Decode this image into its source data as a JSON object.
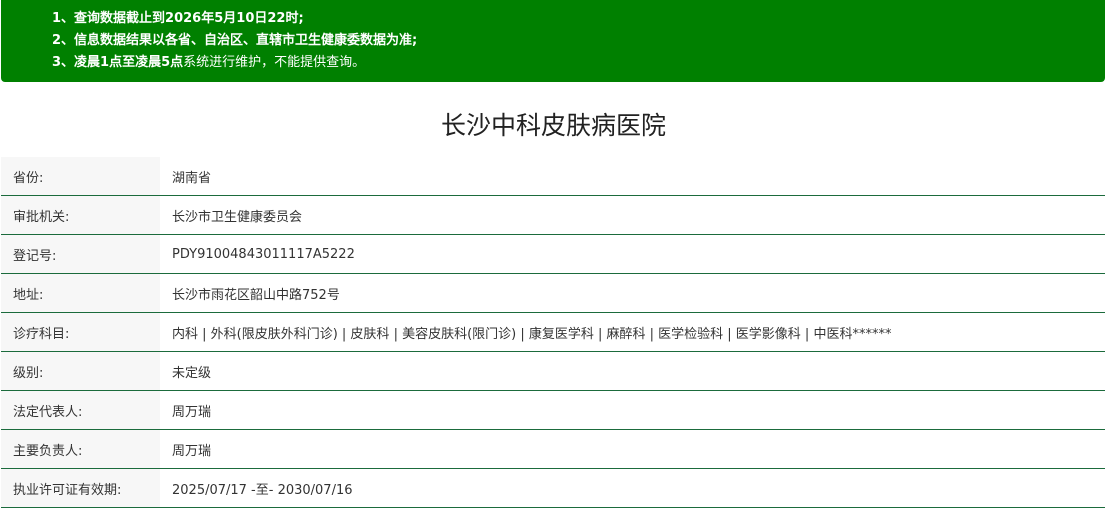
{
  "notice": {
    "line1": {
      "prefix": "1、",
      "text": "查询数据截止到2026年5月10日22时;"
    },
    "line2": {
      "prefix": "2、",
      "text": "信息数据结果以各省、自治区、直辖市卫生健康委数据为准;"
    },
    "line3": {
      "prefix": "3、",
      "bold": "凌晨1点至凌晨5点",
      "text": "系统进行维护，不能提供查询。"
    }
  },
  "hospital": {
    "name": "长沙中科皮肤病医院"
  },
  "rows": [
    {
      "label": "省份:",
      "value": "湖南省"
    },
    {
      "label": "审批机关:",
      "value": "长沙市卫生健康委员会"
    },
    {
      "label": "登记号:",
      "value": "PDY91004843011117A5222"
    },
    {
      "label": "地址:",
      "value": "长沙市雨花区韶山中路752号"
    },
    {
      "label": "诊疗科目:",
      "value": "内科 | 外科(限皮肤外科门诊) | 皮肤科 | 美容皮肤科(限门诊) | 康复医学科 | 麻醉科 | 医学检验科 | 医学影像科 | 中医科******"
    },
    {
      "label": "级别:",
      "value": "未定级"
    },
    {
      "label": "法定代表人:",
      "value": "周万瑞"
    },
    {
      "label": "主要负责人:",
      "value": "周万瑞"
    },
    {
      "label": "执业许可证有效期:",
      "value": "2025/07/17 -至- 2030/07/16"
    }
  ],
  "colors": {
    "notice_background": "#008000",
    "row_divider": "#1b6b3c",
    "label_background": "#f7f7f7"
  }
}
